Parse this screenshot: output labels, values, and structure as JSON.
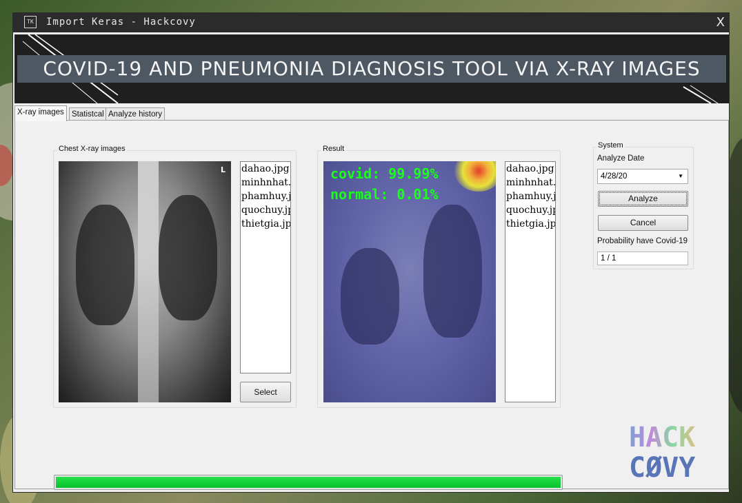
{
  "window": {
    "title": "Import Keras - Hackcovy",
    "tk_icon": "tk-icon",
    "close_label": "X"
  },
  "banner": {
    "heading": "COVID-19 AND PNEUMONIA DIAGNOSIS TOOL VIA X-RAY IMAGES"
  },
  "tabs": [
    {
      "label": "X-ray images",
      "active": true
    },
    {
      "label": "Statistcal",
      "active": false
    },
    {
      "label": "Analyze history",
      "active": false
    }
  ],
  "chest_panel": {
    "label": "Chest X-ray images",
    "image_marker": "L",
    "files": [
      "dahao.jpg",
      "minhnhat.jpg",
      "phamhuy.jpg",
      "quochuy.jpg",
      "thietgia.jpg"
    ],
    "select_label": "Select"
  },
  "result_panel": {
    "label": "Result",
    "overlay_lines": [
      "covid: 99.99%",
      "normal: 0.01%"
    ],
    "files": [
      "dahao.jpg",
      "minhnhat.jpg",
      "phamhuy.jpg",
      "quochuy.jpg",
      "thietgia.jpg"
    ]
  },
  "system_panel": {
    "label": "System",
    "date_label": "Analyze Date",
    "date_value": "4/28/20",
    "analyze_label": "Analyze",
    "cancel_label": "Cancel",
    "prob_label": "Probability have Covid-19",
    "prob_value": "1 / 1"
  },
  "progress": {
    "percent": 100,
    "color": "#06c22c"
  },
  "logo": {
    "line1": "HACK",
    "line2": "CØVY"
  },
  "colors": {
    "titlebar": "#2b2b2b",
    "banner": "#1f1f1f",
    "banner_stripe": "#4e5862",
    "overlay_text": "#18ff18"
  }
}
